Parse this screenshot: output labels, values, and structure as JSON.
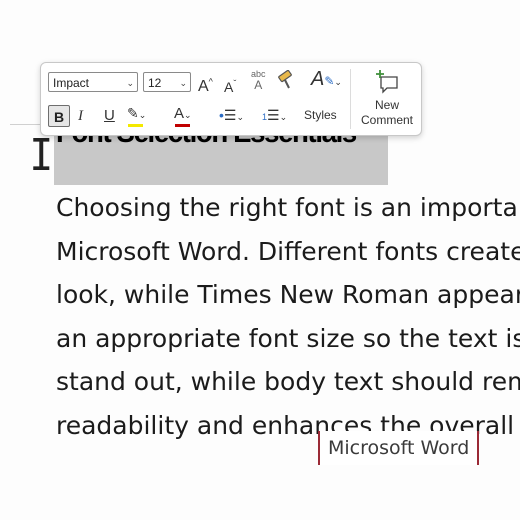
{
  "mini_toolbar": {
    "font_name": "Impact",
    "font_size": "12",
    "grow_font_icon": "A^",
    "shrink_font_icon": "Aˇ",
    "clear_format_icon": "abc A",
    "bold": "B",
    "italic": "I",
    "underline": "U",
    "styles_label": "Styles",
    "new_comment_line1": "New",
    "new_comment_line2": "Comment",
    "colors": {
      "highlight": "#f4e900",
      "font_color": "#c00000",
      "accent_blue": "#2b6cc4",
      "comment_green": "#3f8f3a"
    }
  },
  "document": {
    "heading": "Font Selection Essentials",
    "lines": [
      "Choosing the right font is an importar",
      "Microsoft Word. Different fonts create",
      "look, while Times New Roman appear",
      "an appropriate font size so the text is",
      "stand out, while body text should rem",
      "readability and enhances the overall a"
    ]
  },
  "tooltip": {
    "text": "Microsoft Word"
  }
}
